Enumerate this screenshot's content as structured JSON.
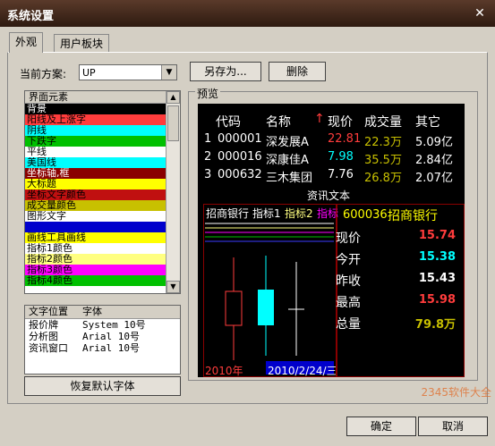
{
  "window": {
    "title": "系统设置",
    "close": "✕"
  },
  "tabs": [
    {
      "label": "外观"
    },
    {
      "label": "用户板块"
    }
  ],
  "scheme": {
    "label": "当前方案:",
    "value": "UP"
  },
  "buttons": {
    "save_as": "另存为...",
    "delete": "删除",
    "restore_font": "恢复默认字体",
    "ok": "确定",
    "cancel": "取消"
  },
  "elements": {
    "header": "界面元素",
    "items": [
      {
        "label": "背景",
        "color": "#000000",
        "text_color": "#ffffff"
      },
      {
        "label": "阳线及上涨字",
        "color": "#ff3c3c",
        "text_color": "#000000"
      },
      {
        "label": "阴线",
        "color": "#00ffff",
        "text_color": "#000000"
      },
      {
        "label": "下跌字",
        "color": "#00c000",
        "text_color": "#000000"
      },
      {
        "label": "平线",
        "color": "#ffffff",
        "text_color": "#000000"
      },
      {
        "label": "美国线",
        "color": "#00ffff",
        "text_color": "#000000"
      },
      {
        "label": "坐标轴,框",
        "color": "#8a0000",
        "text_color": "#ffffff"
      },
      {
        "label": "大标题",
        "color": "#ffff00",
        "text_color": "#000000"
      },
      {
        "label": "坐标文字颜色",
        "color": "#c01010",
        "text_color": "#000000"
      },
      {
        "label": "成交量颜色",
        "color": "#c8c000",
        "text_color": "#000000"
      },
      {
        "label": "图形文字",
        "color": "#ffffff",
        "text_color": "#000000"
      },
      {
        "label": "",
        "color": "#0000cc",
        "text_color": "#ffffff"
      },
      {
        "label": "画线工具画线",
        "color": "#ffff00",
        "text_color": "#000000"
      },
      {
        "label": "指标1颜色",
        "color": "#ffffff",
        "text_color": "#000000"
      },
      {
        "label": "指标2颜色",
        "color": "#ffff80",
        "text_color": "#000000"
      },
      {
        "label": "指标3颜色",
        "color": "#ff00ff",
        "text_color": "#000000"
      },
      {
        "label": "指标4颜色",
        "color": "#00c000",
        "text_color": "#000000"
      }
    ]
  },
  "fonts": {
    "headers": [
      "文字位置",
      "字体"
    ],
    "rows": [
      {
        "pos": "报价牌",
        "font": "System 10号"
      },
      {
        "pos": "分析图",
        "font": "Arial 10号"
      },
      {
        "pos": "资讯窗口",
        "font": "Arial 10号"
      }
    ]
  },
  "preview": {
    "label": "预览",
    "columns": [
      "代码",
      "名称",
      "↑",
      "现价",
      "成交量",
      "其它"
    ],
    "rows": [
      {
        "idx": "1",
        "code": "000001",
        "name": "深发展A",
        "price": "22.81",
        "volume": "22.3万",
        "other": "5.09亿",
        "price_color": "#ff3c3c"
      },
      {
        "idx": "2",
        "code": "000016",
        "name": "深康佳A",
        "price": "7.98",
        "volume": "35.5万",
        "other": "2.84亿",
        "price_color": "#00ffff"
      },
      {
        "idx": "3",
        "code": "000632",
        "name": "三木集团",
        "price": "7.76",
        "volume": "26.8万",
        "other": "2.07亿",
        "price_color": "#ffffff"
      }
    ],
    "info_text": "资讯文本",
    "chart_legend": [
      "招商银行",
      "指标1",
      "指标2",
      "指标"
    ],
    "stock_title": {
      "code": "600036",
      "name": "招商银行"
    },
    "quote": [
      {
        "label": "现价",
        "value": "15.74",
        "color": "#ff3c3c"
      },
      {
        "label": "今开",
        "value": "15.38",
        "color": "#00ffff"
      },
      {
        "label": "昨收",
        "value": "15.43",
        "color": "#ffffff"
      },
      {
        "label": "最高",
        "value": "15.98",
        "color": "#ff3c3c"
      },
      {
        "label": "总量",
        "value": "79.8万",
        "color": "#c8c000"
      }
    ],
    "date_left": "2010年",
    "date_right": "2010/2/24/三"
  },
  "watermark": "2345软件大全"
}
